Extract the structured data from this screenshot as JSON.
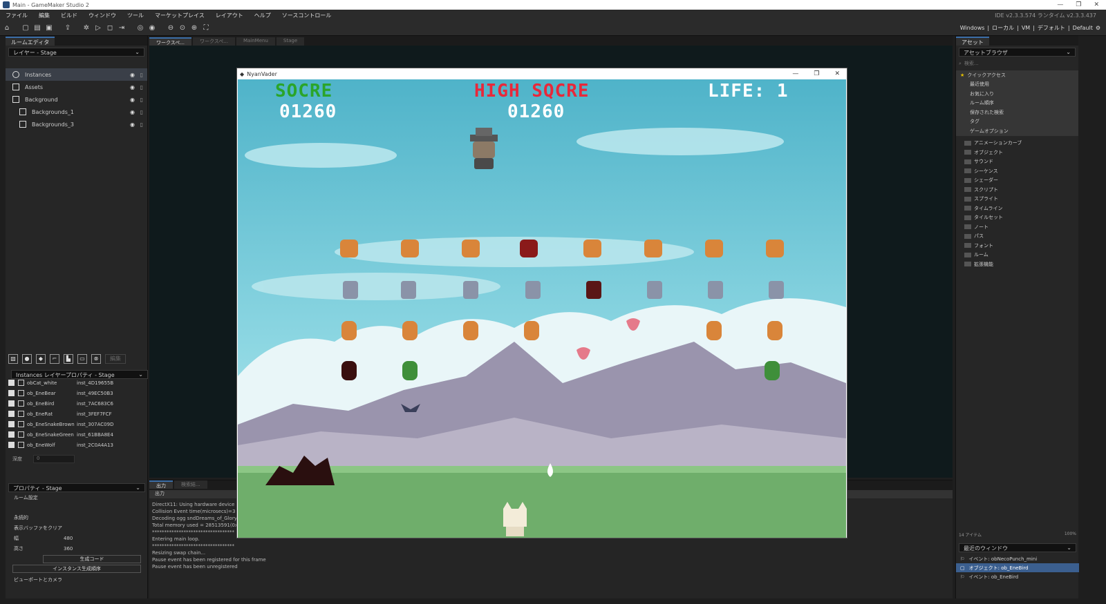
{
  "window": {
    "title": "Main - GameMaker Studio 2",
    "controls": [
      "—",
      "❐",
      "✕"
    ]
  },
  "menu": [
    "ファイル",
    "編集",
    "ビルド",
    "ウィンドウ",
    "ツール",
    "マーケットプレイス",
    "レイアウト",
    "ヘルプ",
    "ソースコントロール"
  ],
  "ide_version": "IDE v2.3.3.574 ランタイム v2.3.3.437",
  "target": {
    "platform": "Windows",
    "device": "ローカル",
    "vm": "VM",
    "config": "デフォルト",
    "layout": "Default"
  },
  "left_panel": {
    "tab": "ルームエディタ",
    "layer_dropdown": "レイヤー - Stage",
    "layers": [
      "Instances",
      "Assets",
      "Background",
      "Backgrounds_1",
      "Backgrounds_3"
    ],
    "edit_button": "編集",
    "instances_dropdown": "Instances レイヤープロパティ - Stage",
    "instances": [
      {
        "object": "obCat_white",
        "id": "inst_4D19655B"
      },
      {
        "object": "ob_EneBear",
        "id": "inst_49EC50B3"
      },
      {
        "object": "ob_EneBird",
        "id": "inst_7AC683C6"
      },
      {
        "object": "ob_EneRat",
        "id": "inst_3FEF7FCF"
      },
      {
        "object": "ob_EneSnakeBrown",
        "id": "inst_307AC09D"
      },
      {
        "object": "ob_EneSnakeGreen",
        "id": "inst_61BBA8E4"
      },
      {
        "object": "ob_EneWolf",
        "id": "inst_2C0A4A13"
      }
    ],
    "depth_label": "深度",
    "depth_value": "0",
    "props_dropdown": "プロパティ - Stage",
    "room_settings": "ルーム設定",
    "persistent": "永続的",
    "clear_buffer": "表示バッファをクリア",
    "width_label": "幅",
    "width_value": "480",
    "height_label": "高さ",
    "height_value": "360",
    "creation_code": "生成コード",
    "instance_order": "インスタンス生成順序",
    "viewports": "ビューポートとカメラ"
  },
  "workspace_tabs": [
    "ワークスペ...",
    "ワークスペ...",
    "MainMenu",
    "Stage"
  ],
  "output": {
    "tabs": [
      "出力",
      "検索結..."
    ],
    "header": "出力",
    "lines": [
      "DirectX11: Using hardware device",
      "Collision Event time(microsecs)=3",
      "Decoding ogg sndDreams_of_Glory...",
      "Total memory used = 28513591(0x0...",
      "**********************************",
      "Entering main loop.",
      "**********************************",
      "Resizing swap chain...",
      "Pause event has been registered for this frame",
      "Pause event has been unregistered"
    ]
  },
  "right_panel": {
    "tab": "アセット",
    "dropdown": "アセットブラウザ",
    "search_placeholder": "検索...",
    "quick_access": "クイックアクセス",
    "quick_items": [
      "最近使用",
      "お気に入り",
      "ルーム順序",
      "保存された検索",
      "タグ",
      "ゲームオプション"
    ],
    "folders": [
      "アニメーションカーブ",
      "オブジェクト",
      "サウンド",
      "シーケンス",
      "シェーダー",
      "スクリプト",
      "スプライト",
      "タイムライン",
      "タイルセット",
      "ノート",
      "パス",
      "フォント",
      "ルーム",
      "拡張機能"
    ],
    "item_count": "14 アイテム",
    "zoom": "100%",
    "recent_dropdown": "最近のウィンドウ",
    "recent": [
      "イベント: obNecoPunch_mini",
      "オブジェクト: ob_EneBird",
      "イベント: ob_EneBird"
    ]
  },
  "game": {
    "title": "NyanVader",
    "score_label": "SOCRE",
    "score": "01260",
    "high_label": "HIGH SQCRE",
    "high_score": "01260",
    "life_label": "LIFE: 1",
    "colors": {
      "score": "#2aa52a",
      "high": "#e8283a",
      "life": "#ffffff"
    }
  }
}
